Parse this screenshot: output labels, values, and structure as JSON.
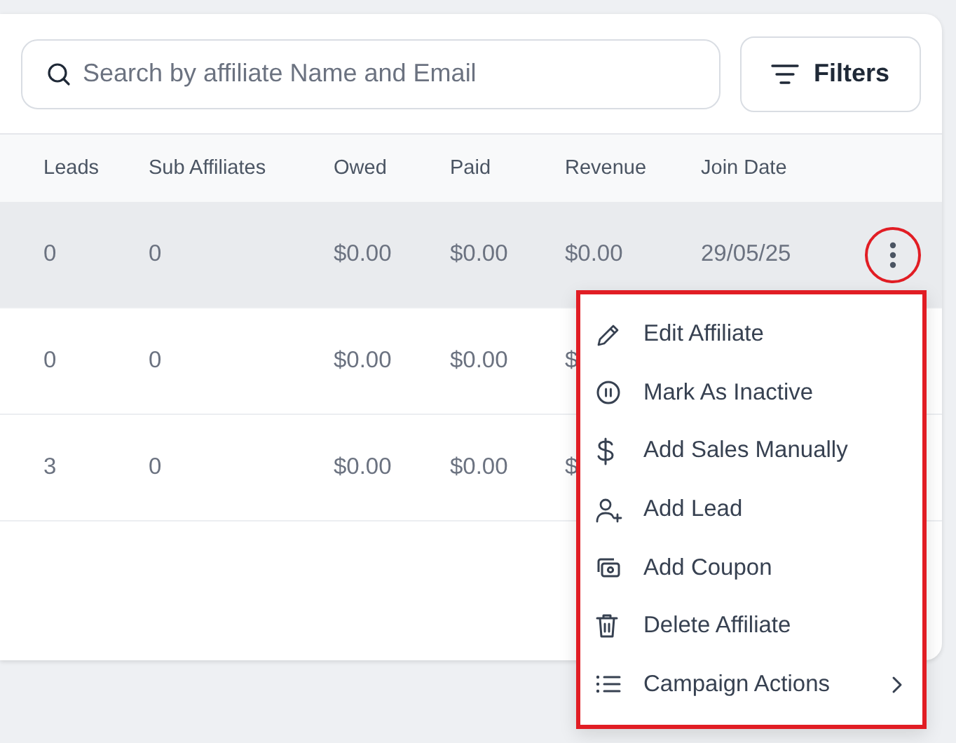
{
  "search": {
    "placeholder": "Search by affiliate Name and Email"
  },
  "filters_button": {
    "label": "Filters"
  },
  "table": {
    "columns": [
      "Leads",
      "Sub Affiliates",
      "Owed",
      "Paid",
      "Revenue",
      "Join Date"
    ],
    "rows": [
      {
        "highlighted": true,
        "cells": [
          "0",
          "0",
          "$0.00",
          "$0.00",
          "$0.00",
          "29/05/25"
        ],
        "actions_button": {
          "annotated": true
        }
      },
      {
        "highlighted": false,
        "cells": [
          "0",
          "0",
          "$0.00",
          "$0.00",
          "$"
        ]
      },
      {
        "highlighted": false,
        "cells": [
          "3",
          "0",
          "$0.00",
          "$0.00",
          "$"
        ]
      }
    ]
  },
  "action_menu": {
    "annotated": true,
    "items": [
      {
        "label": "Edit Affiliate",
        "submenu": false
      },
      {
        "label": "Mark As Inactive",
        "submenu": false
      },
      {
        "label": "Add Sales Manually",
        "submenu": false
      },
      {
        "label": "Add Lead",
        "submenu": false
      },
      {
        "label": "Add Coupon",
        "submenu": false
      },
      {
        "label": "Delete Affiliate",
        "submenu": false
      },
      {
        "label": "Campaign Actions",
        "submenu": true
      }
    ]
  }
}
